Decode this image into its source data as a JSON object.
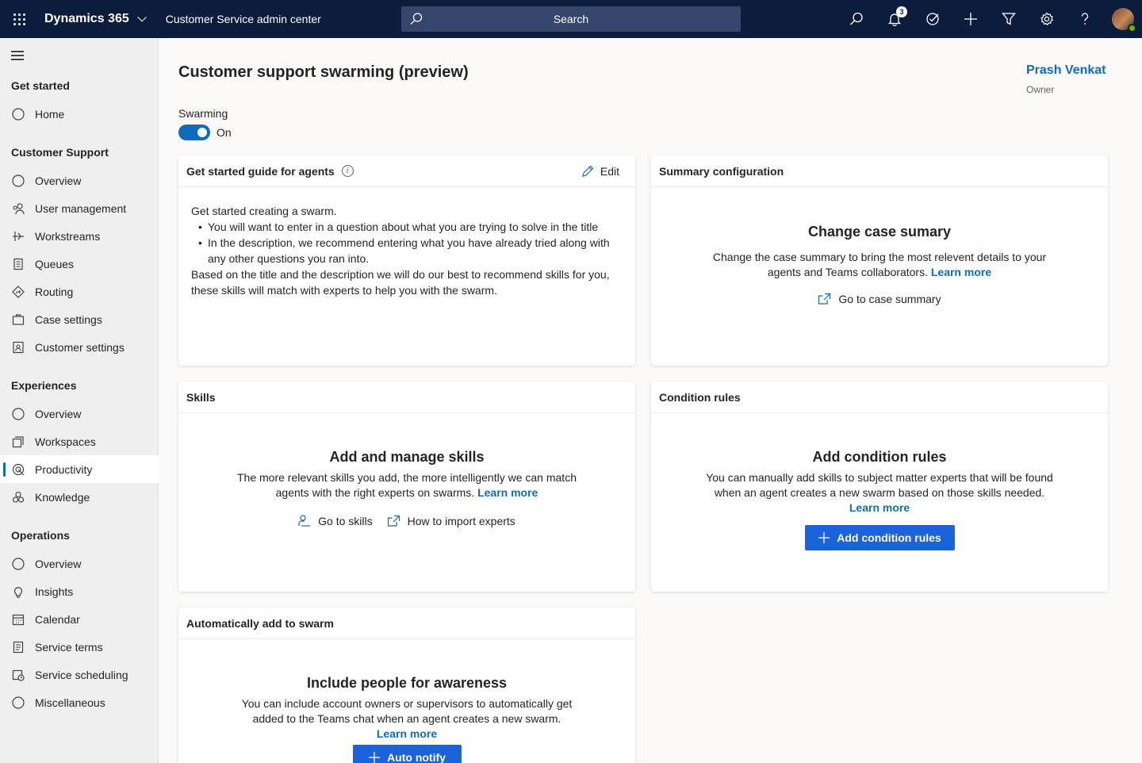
{
  "topbar": {
    "brand": "Dynamics 365",
    "app_title": "Customer Service admin center",
    "search_placeholder": "Search",
    "notification_count": "3"
  },
  "sidebar": {
    "groups": [
      {
        "title": "Get started",
        "items": [
          {
            "label": "Home",
            "icon": "circle-icon"
          }
        ]
      },
      {
        "title": "Customer Support",
        "items": [
          {
            "label": "Overview",
            "icon": "circle-icon"
          },
          {
            "label": "User management",
            "icon": "people-icon"
          },
          {
            "label": "Workstreams",
            "icon": "workstream-icon"
          },
          {
            "label": "Queues",
            "icon": "queue-icon"
          },
          {
            "label": "Routing",
            "icon": "routing-icon"
          },
          {
            "label": "Case settings",
            "icon": "briefcase-icon"
          },
          {
            "label": "Customer settings",
            "icon": "contact-card-icon"
          }
        ]
      },
      {
        "title": "Experiences",
        "items": [
          {
            "label": "Overview",
            "icon": "circle-icon"
          },
          {
            "label": "Workspaces",
            "icon": "workspaces-icon"
          },
          {
            "label": "Productivity",
            "icon": "productivity-icon",
            "active": true
          },
          {
            "label": "Knowledge",
            "icon": "knowledge-icon"
          }
        ]
      },
      {
        "title": "Operations",
        "items": [
          {
            "label": "Overview",
            "icon": "circle-icon"
          },
          {
            "label": "Insights",
            "icon": "lightbulb-icon"
          },
          {
            "label": "Calendar",
            "icon": "calendar-icon"
          },
          {
            "label": "Service terms",
            "icon": "document-icon"
          },
          {
            "label": "Service scheduling",
            "icon": "scheduling-icon"
          },
          {
            "label": "Miscellaneous",
            "icon": "circle-icon"
          }
        ]
      }
    ]
  },
  "page": {
    "title": "Customer support swarming (preview)",
    "owner_name": "Prash Venkat",
    "owner_role": "Owner",
    "swarming_label": "Swarming",
    "swarming_state": "On"
  },
  "guide": {
    "title": "Get started guide for agents",
    "edit_label": "Edit",
    "intro": "Get started creating a swarm.",
    "bullets": [
      "You will want to enter in a question about what you are trying to solve in the title",
      "In the description, we recommend entering what you have already tried along with any other questions you ran into."
    ],
    "outro": "Based on the title and the description we will do our best to recommend skills for you, these skills will match with experts to help you with the swarm."
  },
  "summary": {
    "header": "Summary configuration",
    "title": "Change case sumary",
    "desc": "Change the case summary to bring the most relevent details to your agents and Teams collaborators.",
    "link": "Learn more",
    "action": "Go to case summary"
  },
  "skills": {
    "header": "Skills",
    "title": "Add and manage skills",
    "desc": "The more relevant skills you add, the more intelligently we can match agents with the right experts on swarms.",
    "link": "Learn more",
    "action1": "Go to skills",
    "action2": "How to import experts"
  },
  "conditions": {
    "header": "Condition rules",
    "title": "Add condition rules",
    "desc": "You can manually add skills to subject matter experts that will be found when an agent creates a new swarm based on those skills needed.",
    "link": "Learn more",
    "button": "Add condition rules"
  },
  "auto": {
    "header": "Automatically add to swarm",
    "title": "Include people for awareness",
    "desc": "You can include account owners or supervisors to automatically get added to the Teams chat when an agent creates a new swarm.",
    "link": "Learn more",
    "button": "Auto notify"
  },
  "colors": {
    "topbar": "#0b1c3d",
    "accent": "#0f6cbd",
    "primary_button": "#1a63db"
  }
}
